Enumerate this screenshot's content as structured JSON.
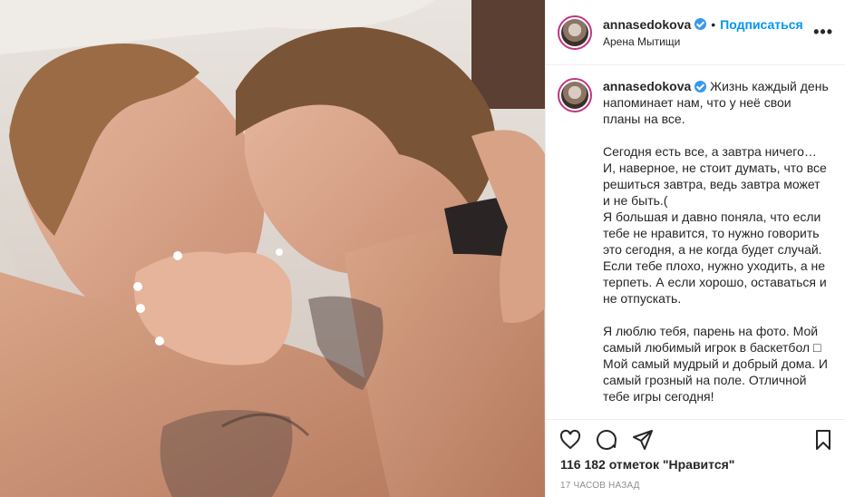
{
  "post": {
    "username": "annasedokova",
    "follow_label": "Подписаться",
    "separator": "•",
    "location": "Арена Мытищи",
    "more_label": "•••",
    "caption": "Жизнь каждый день напоминает нам, что у неё свои планы на все.\n\nСегодня есть все, а завтра ничего…\nИ, наверное, не стоит думать, что все решиться завтра, ведь завтра может и не быть.(\nЯ большая и давно поняла, что если тебе не нравится, то нужно говорить это сегодня, а не когда будет случай. Если тебе плохо, нужно уходить, а не терпеть. А если хорошо, оставаться и не отпускать.\n\nЯ люблю тебя, парень на фото. Мой самый любимый игрок в баскетбол □ Мой самый мудрый и добрый дома. И самый грозный на поле. Отличной тебе игры сегодня!",
    "likes": "116 182 отметок \"Нравится\"",
    "time": "17 часов назад"
  },
  "icons": {
    "like": "heart-icon",
    "comment": "comment-icon",
    "share": "share-icon",
    "save": "bookmark-icon",
    "verified": "verified-badge-icon"
  },
  "colors": {
    "accent": "#0095f6",
    "verified": "#3897f0",
    "text": "#262626",
    "muted": "#8e8e8e",
    "border": "#efefef"
  }
}
